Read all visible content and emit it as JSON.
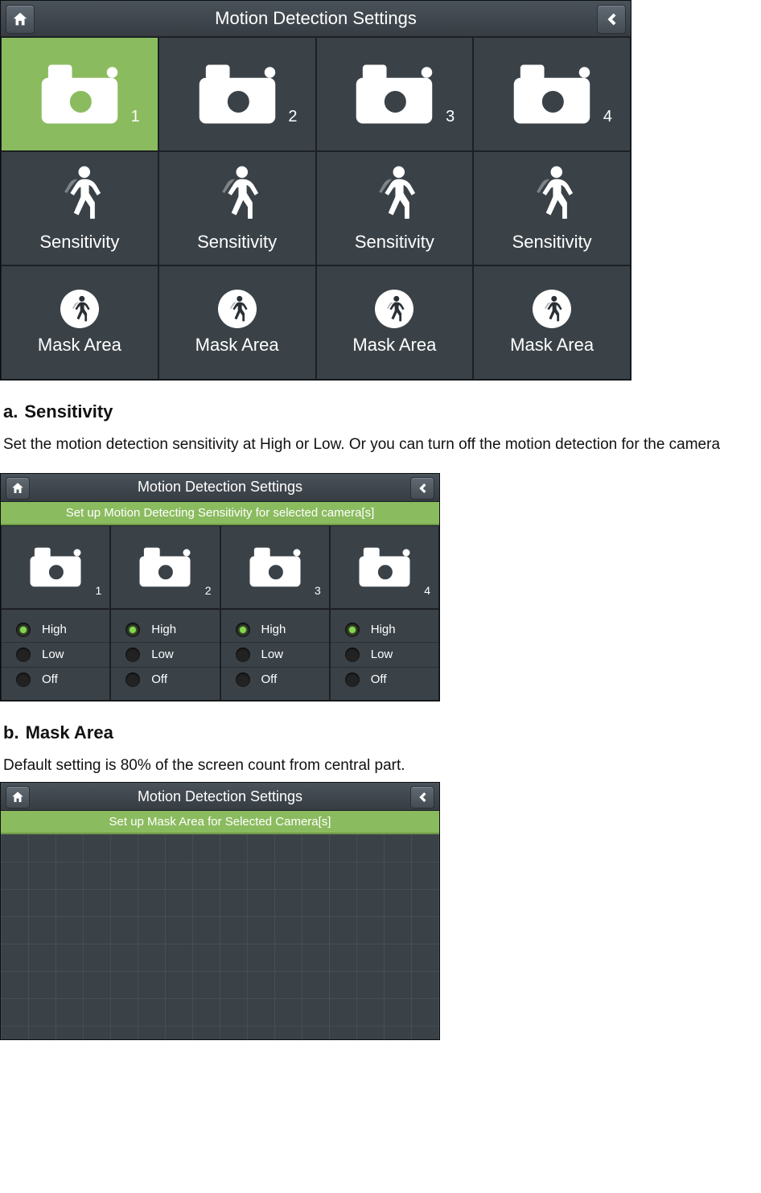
{
  "device1": {
    "title": "Motion Detection Settings",
    "cameras": [
      {
        "num": "1",
        "selected": true
      },
      {
        "num": "2",
        "selected": false
      },
      {
        "num": "3",
        "selected": false
      },
      {
        "num": "4",
        "selected": false
      }
    ],
    "sensitivity_label": "Sensitivity",
    "mask_label": "Mask Area"
  },
  "section_a": {
    "letter": "a.",
    "title": "Sensitivity",
    "body": "Set the motion detection sensitivity at High or Low. Or you can turn off the motion detection for the camera"
  },
  "device2": {
    "title": "Motion Detection Settings",
    "banner": "Set up Motion Detecting Sensitivity for selected camera[s]",
    "cameras": [
      "1",
      "2",
      "3",
      "4"
    ],
    "options": [
      "High",
      "Low",
      "Off"
    ],
    "columns": [
      {
        "selected": "High"
      },
      {
        "selected": "High"
      },
      {
        "selected": "High"
      },
      {
        "selected": "High"
      }
    ]
  },
  "section_b": {
    "letter": "b.",
    "title": "Mask Area",
    "body": "Default setting is 80% of the screen count from central part."
  },
  "device3": {
    "title": "Motion Detection Settings",
    "banner": "Set up Mask Area for Selected Camera[s]"
  }
}
